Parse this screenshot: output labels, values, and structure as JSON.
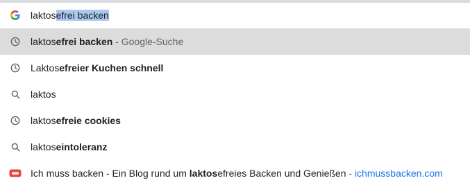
{
  "input": {
    "typed": "laktos",
    "autocomplete": "efrei backen"
  },
  "suggestions": [
    {
      "type": "history",
      "icon": "clock-icon",
      "prefix": "laktos",
      "bold": "efrei backen",
      "separator": " - ",
      "suffix": "Google-Suche"
    },
    {
      "type": "history",
      "icon": "clock-icon",
      "prefix": "Laktos",
      "bold": "efreier Kuchen schnell"
    },
    {
      "type": "search",
      "icon": "search-icon",
      "prefix": "laktos",
      "bold": ""
    },
    {
      "type": "history",
      "icon": "clock-icon",
      "prefix": "laktos",
      "bold": "efreie cookies"
    },
    {
      "type": "search",
      "icon": "search-icon",
      "prefix": "laktos",
      "bold": "eintoleranz"
    },
    {
      "type": "site",
      "icon": "site-favicon-icon",
      "title_start": "Ich muss backen - Ein Blog rund um ",
      "title_bold": "laktos",
      "title_end": "efreies Backen und Genießen",
      "separator": " - ",
      "url": "ichmussbacken.com"
    }
  ],
  "colors": {
    "selected_row": "#dcdcdc",
    "autocomplete_highlight": "#aac8f0",
    "url_link": "#1a73e8",
    "favicon": "#e8453c"
  }
}
